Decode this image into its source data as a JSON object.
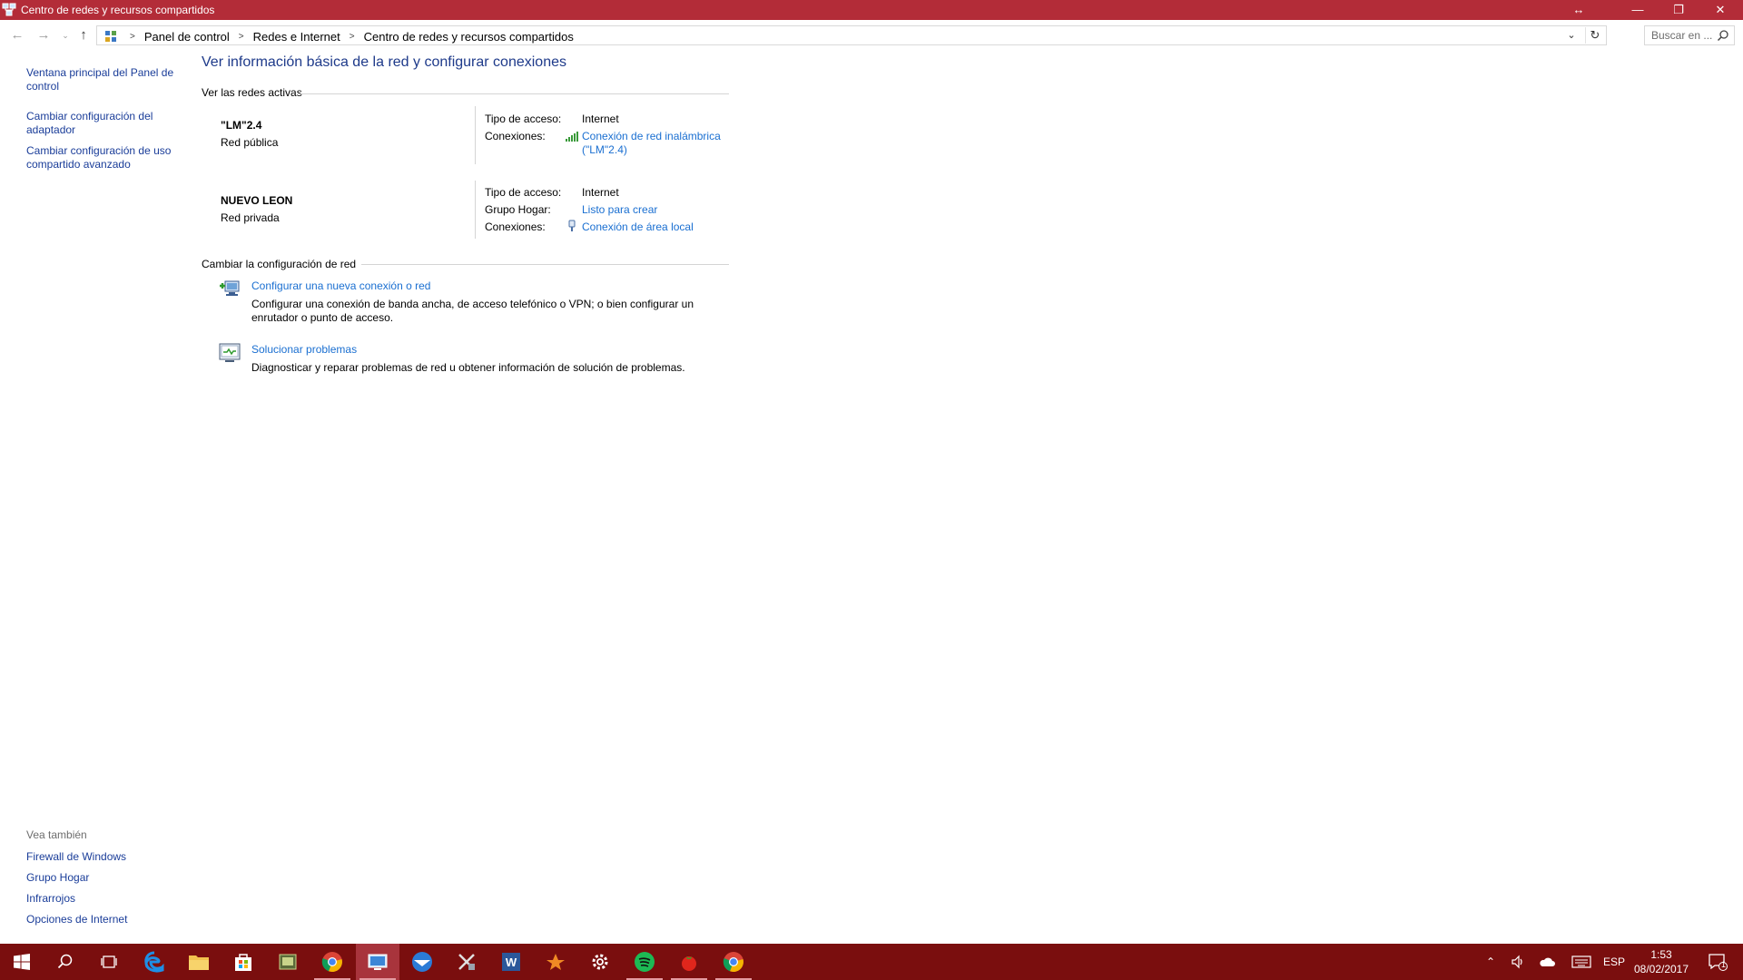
{
  "window": {
    "title": "Centro de redes y recursos compartidos",
    "controls": {
      "resize": "↔",
      "minimize": "—",
      "restore": "❐",
      "close": "✕"
    }
  },
  "address_bar": {
    "breadcrumbs": [
      "Panel de control",
      "Redes e Internet",
      "Centro de redes y recursos compartidos"
    ],
    "search_placeholder": "Buscar en ..."
  },
  "left_pane": {
    "links": [
      "Ventana principal del Panel de control",
      "Cambiar configuración del adaptador",
      "Cambiar configuración de uso compartido avanzado"
    ],
    "see_also_title": "Vea también",
    "see_also": [
      "Firewall de Windows",
      "Grupo Hogar",
      "Infrarrojos",
      "Opciones de Internet"
    ]
  },
  "main": {
    "heading": "Ver información básica de la red y configurar conexiones",
    "active_networks_title": "Ver las redes activas",
    "networks": [
      {
        "name": "\"LM\"2.4",
        "type": "Red pública",
        "access_label": "Tipo de acceso:",
        "access_value": "Internet",
        "connections_label": "Conexiones:",
        "connection_link": "Conexión de red inalámbrica (\"LM\"2.4)",
        "connection_icon": "wifi-signal-icon"
      },
      {
        "name": "NUEVO LEON",
        "type": "Red privada",
        "access_label": "Tipo de acceso:",
        "access_value": "Internet",
        "homegroup_label": "Grupo Hogar:",
        "homegroup_link": "Listo para crear",
        "connections_label": "Conexiones:",
        "connection_link": "Conexión de área local",
        "connection_icon": "ethernet-icon"
      }
    ],
    "change_settings_title": "Cambiar la configuración de red",
    "tasks": [
      {
        "link": "Configurar una nueva conexión o red",
        "description": "Configurar una conexión de banda ancha, de acceso telefónico o VPN; o bien configurar un enrutador o punto de acceso.",
        "icon": "new-connection-icon"
      },
      {
        "link": "Solucionar problemas",
        "description": "Diagnosticar y reparar problemas de red u obtener información de solución de problemas.",
        "icon": "troubleshoot-icon"
      }
    ]
  },
  "taskbar": {
    "apps": [
      "start-icon",
      "search-icon",
      "task-view-icon",
      "edge-icon",
      "file-explorer-icon",
      "store-icon",
      "app-icon",
      "chrome-icon",
      "control-panel-icon",
      "thunderbird-icon",
      "tools-icon",
      "word-icon",
      "avast-icon",
      "settings-icon",
      "spotify-icon",
      "app-tomato-icon",
      "chrome-icon"
    ],
    "tray": {
      "language": "ESP",
      "time": "1:53",
      "date": "08/02/2017",
      "notification_count": "1"
    }
  },
  "colors": {
    "titlebar": "#b32c38",
    "taskbar": "#7a0e0e",
    "link": "#1a6fd1",
    "heading": "#1e3a8a"
  }
}
